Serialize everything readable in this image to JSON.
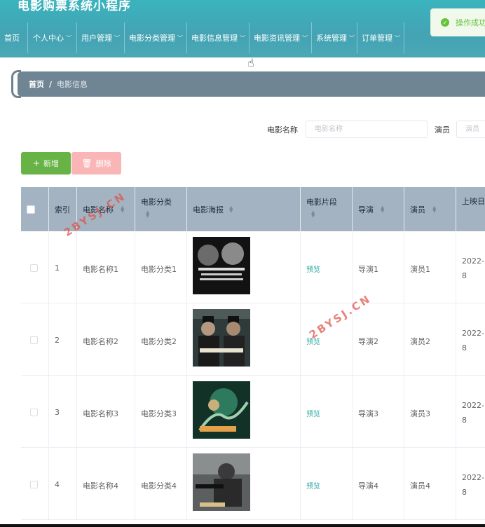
{
  "app": {
    "title": "电影购票系统小程序"
  },
  "nav": [
    {
      "label": "首页",
      "dropdown": false
    },
    {
      "label": "个人中心",
      "dropdown": true
    },
    {
      "label": "用户管理",
      "dropdown": true
    },
    {
      "label": "电影分类管理",
      "dropdown": true
    },
    {
      "label": "电影信息管理",
      "dropdown": true
    },
    {
      "label": "电影资讯管理",
      "dropdown": true
    },
    {
      "label": "系统管理",
      "dropdown": true
    },
    {
      "label": "订单管理",
      "dropdown": true
    }
  ],
  "toast": {
    "text": "操作成功"
  },
  "breadcrumb": {
    "home": "首页",
    "separator": "/",
    "current": "电影信息"
  },
  "search": {
    "name_label": "电影名称",
    "name_placeholder": "电影名称",
    "actor_label": "演员",
    "actor_placeholder": "演员"
  },
  "toolbar": {
    "add_label": "新增",
    "delete_label": "删除"
  },
  "table": {
    "headers": [
      "索引",
      "电影名称",
      "电影分类",
      "电影海报",
      "电影片段",
      "导演",
      "演员",
      "上映日"
    ],
    "rows": [
      {
        "index": "1",
        "name": "电影名称1",
        "category": "电影分类1",
        "poster_icon": "poster-1",
        "clip": "预览",
        "director": "导演1",
        "actor": "演员1",
        "date_line1": "2022-",
        "date_line2": "8"
      },
      {
        "index": "2",
        "name": "电影名称2",
        "category": "电影分类2",
        "poster_icon": "poster-2",
        "clip": "预览",
        "director": "导演2",
        "actor": "演员2",
        "date_line1": "2022-",
        "date_line2": "8"
      },
      {
        "index": "3",
        "name": "电影名称3",
        "category": "电影分类3",
        "poster_icon": "poster-3",
        "clip": "预览",
        "director": "导演3",
        "actor": "演员3",
        "date_line1": "2022-",
        "date_line2": "8"
      },
      {
        "index": "4",
        "name": "电影名称4",
        "category": "电影分类4",
        "poster_icon": "poster-4",
        "clip": "预览",
        "director": "导演4",
        "actor": "演员4",
        "date_line1": "2022-",
        "date_line2": "8"
      }
    ]
  },
  "watermark": {
    "text": "2BYSJ.CN"
  },
  "colors": {
    "header": "#44a3b4",
    "add": "#67b346",
    "delete": "#fab6b6",
    "thead": "#a4b3c2",
    "breadcrumb": "#6f8594"
  }
}
